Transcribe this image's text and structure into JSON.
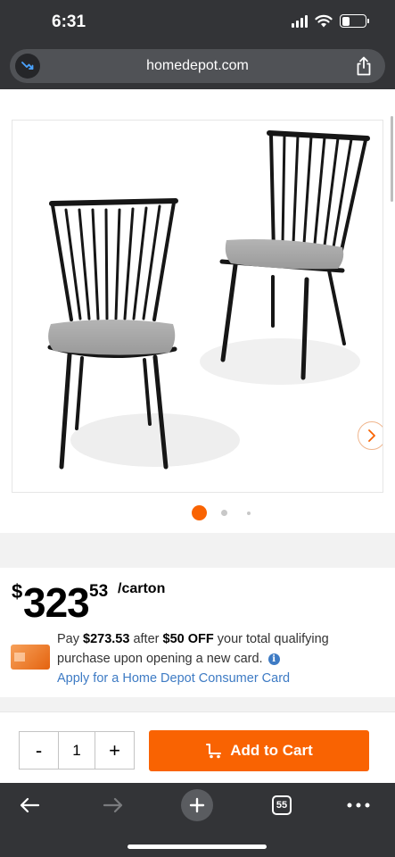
{
  "status_bar": {
    "time": "6:31"
  },
  "browser": {
    "url": "homedepot.com"
  },
  "product": {
    "image_alt": "Two black spindle-back dining chairs with gray seat cushions",
    "carousel_dots": 3,
    "active_dot": 0,
    "price": {
      "currency": "$",
      "dollars": "323",
      "cents": "53",
      "unit": "/carton"
    },
    "promo": {
      "line1_pre": "Pay ",
      "line1_amount": "$273.53",
      "line1_mid": " after ",
      "line1_off": "$50 OFF",
      "line1_post": " your total qualifying",
      "line2": "purchase upon opening a new card.",
      "apply_link": "Apply for a Home Depot Consumer Card"
    }
  },
  "cart": {
    "minus_label": "-",
    "quantity": "1",
    "plus_label": "+",
    "add_to_cart_label": "Add to Cart"
  },
  "toolbar": {
    "tab_count": "55"
  },
  "colors": {
    "brand_orange": "#f96302",
    "link_blue": "#3e7bc4",
    "chrome_dark": "#333437"
  }
}
